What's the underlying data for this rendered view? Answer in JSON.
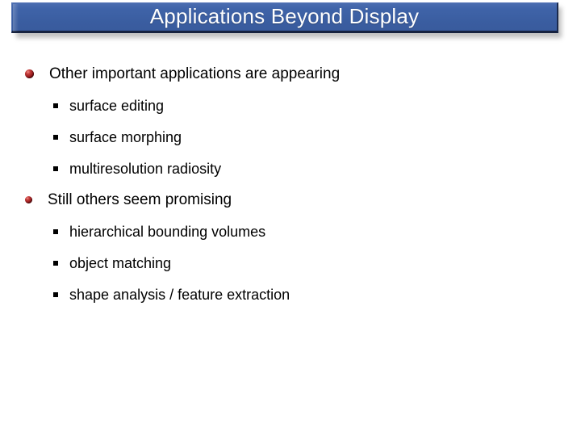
{
  "slide": {
    "title": "Applications Beyond Display",
    "background_color": "#ffffff",
    "title_bar_color": "#3f63a8",
    "title_text_color": "#ffffff",
    "bullet_sphere_color": "#8d1418",
    "bullet_square_color": "#000000",
    "bullets": [
      {
        "level": 1,
        "marker": "sphere-bullet-icon",
        "text": "Other important applications are appearing"
      },
      {
        "level": 2,
        "marker": "square-bullet-icon",
        "text": "surface editing"
      },
      {
        "level": 2,
        "marker": "square-bullet-icon",
        "text": "surface morphing"
      },
      {
        "level": 2,
        "marker": "square-bullet-icon",
        "text": "multiresolution radiosity"
      },
      {
        "level": 1,
        "marker": "sphere-bullet-icon",
        "text": "Still others seem promising"
      },
      {
        "level": 2,
        "marker": "square-bullet-icon",
        "text": "hierarchical bounding volumes"
      },
      {
        "level": 2,
        "marker": "square-bullet-icon",
        "text": "object matching"
      },
      {
        "level": 2,
        "marker": "square-bullet-icon",
        "text": "shape analysis / feature extraction"
      }
    ]
  }
}
